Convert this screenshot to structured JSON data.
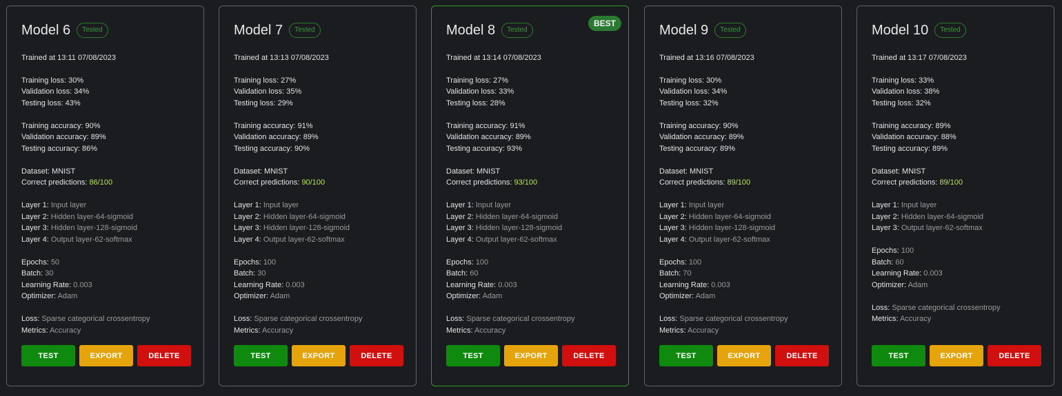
{
  "models": [
    {
      "title": "Model 6",
      "status": "Tested",
      "trained": "Trained at 13:11 07/08/2023",
      "training_loss": "30%",
      "validation_loss": "34%",
      "testing_loss": "43%",
      "training_accuracy": "90%",
      "validation_accuracy": "89%",
      "testing_accuracy": "86%",
      "dataset": "MNIST",
      "correct_predictions": "86/100",
      "layers": [
        "Input layer",
        "Hidden layer-64-sigmoid",
        "Hidden layer-128-sigmoid",
        "Output layer-62-softmax"
      ],
      "epochs": "50",
      "batch": "30",
      "learning_rate": "0.003",
      "optimizer": "Adam",
      "loss": "Sparse categorical crossentropy",
      "metrics": "Accuracy"
    },
    {
      "title": "Model 7",
      "status": "Tested",
      "trained": "Trained at 13:13 07/08/2023",
      "training_loss": "27%",
      "validation_loss": "35%",
      "testing_loss": "29%",
      "training_accuracy": "91%",
      "validation_accuracy": "89%",
      "testing_accuracy": "90%",
      "dataset": "MNIST",
      "correct_predictions": "90/100",
      "layers": [
        "Input layer",
        "Hidden layer-64-sigmoid",
        "Hidden layer-128-sigmoid",
        "Output layer-62-softmax"
      ],
      "epochs": "100",
      "batch": "30",
      "learning_rate": "0.003",
      "optimizer": "Adam",
      "loss": "Sparse categorical crossentropy",
      "metrics": "Accuracy"
    },
    {
      "title": "Model 8",
      "status": "Tested",
      "best_label": "BEST",
      "trained": "Trained at 13:14 07/08/2023",
      "training_loss": "27%",
      "validation_loss": "33%",
      "testing_loss": "28%",
      "training_accuracy": "91%",
      "validation_accuracy": "89%",
      "testing_accuracy": "93%",
      "dataset": "MNIST",
      "correct_predictions": "93/100",
      "layers": [
        "Input layer",
        "Hidden layer-64-sigmoid",
        "Hidden layer-128-sigmoid",
        "Output layer-62-softmax"
      ],
      "epochs": "100",
      "batch": "60",
      "learning_rate": "0.003",
      "optimizer": "Adam",
      "loss": "Sparse categorical crossentropy",
      "metrics": "Accuracy"
    },
    {
      "title": "Model 9",
      "status": "Tested",
      "trained": "Trained at 13:16 07/08/2023",
      "training_loss": "30%",
      "validation_loss": "34%",
      "testing_loss": "32%",
      "training_accuracy": "90%",
      "validation_accuracy": "89%",
      "testing_accuracy": "89%",
      "dataset": "MNIST",
      "correct_predictions": "89/100",
      "layers": [
        "Input layer",
        "Hidden layer-64-sigmoid",
        "Hidden layer-128-sigmoid",
        "Output layer-62-softmax"
      ],
      "epochs": "100",
      "batch": "70",
      "learning_rate": "0.003",
      "optimizer": "Adam",
      "loss": "Sparse categorical crossentropy",
      "metrics": "Accuracy"
    },
    {
      "title": "Model 10",
      "status": "Tested",
      "trained": "Trained at 13:17 07/08/2023",
      "training_loss": "33%",
      "validation_loss": "38%",
      "testing_loss": "32%",
      "training_accuracy": "89%",
      "validation_accuracy": "88%",
      "testing_accuracy": "89%",
      "dataset": "MNIST",
      "correct_predictions": "89/100",
      "layers": [
        "Input layer",
        "Hidden layer-64-sigmoid",
        "Output layer-62-softmax"
      ],
      "epochs": "100",
      "batch": "60",
      "learning_rate": "0.003",
      "optimizer": "Adam",
      "loss": "Sparse categorical crossentropy",
      "metrics": "Accuracy"
    }
  ],
  "labels": {
    "training_loss": "Training loss:",
    "validation_loss": "Validation loss:",
    "testing_loss": "Testing loss:",
    "training_accuracy": "Training accuracy:",
    "validation_accuracy": "Validation accuracy:",
    "testing_accuracy": "Testing accuracy:",
    "dataset": "Dataset:",
    "correct_predictions": "Correct predictions:",
    "layer_prefix": "Layer",
    "epochs": "Epochs:",
    "batch": "Batch:",
    "learning_rate": "Learning Rate:",
    "optimizer": "Optimizer:",
    "loss": "Loss:",
    "metrics": "Metrics:"
  },
  "buttons": {
    "test": "TEST",
    "export": "EXPORT",
    "delete": "DELETE"
  },
  "colors": {
    "background": "#1b1c1f",
    "card_border": "#5e6064",
    "best_border": "#2e9a2a",
    "best_badge": "#2a7a32",
    "tested_text": "#3a9a3a",
    "prediction_text": "#b5e35a",
    "test_button": "#0f8a0f",
    "export_button": "#e5a40b",
    "delete_button": "#d20f0f"
  }
}
